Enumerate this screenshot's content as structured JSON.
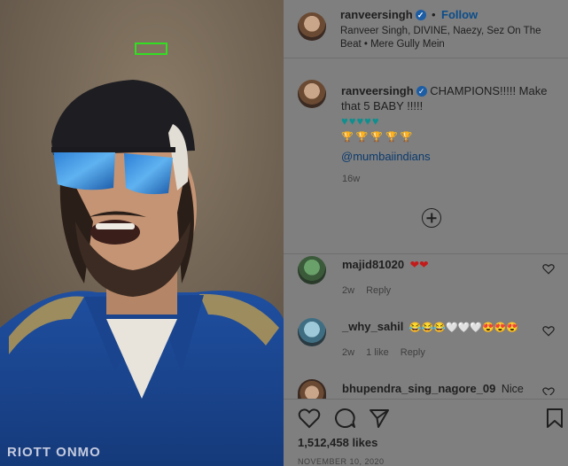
{
  "header": {
    "username": "ranveersingh",
    "dot": "•",
    "follow_label": "Follow",
    "audio": "Ranveer Singh, DIVINE, Naezy, Sez On The Beat • Mere Gully Mein"
  },
  "caption": {
    "username": "ranveersingh",
    "text": "CHAMPIONS!!!!! Make that 5 BABY !!!!!",
    "hearts": [
      "♥",
      "♥",
      "♥",
      "♥",
      "♥"
    ],
    "trophies": [
      "🏆",
      "🏆",
      "🏆",
      "🏆",
      "🏆"
    ],
    "mention": "@mumbaiindians",
    "time": "16w"
  },
  "comments": [
    {
      "username": "majid81020",
      "text": "❤❤",
      "time": "2w",
      "reply": "Reply",
      "likes": ""
    },
    {
      "username": "_why_sahil",
      "text": "😂😂😂🤍🤍🤍😍😍😍",
      "time": "2w",
      "likes": "1 like",
      "reply": "Reply"
    },
    {
      "username": "bhupendra_sing_nagore_09",
      "text": "Nice",
      "time": "",
      "reply": "",
      "likes": ""
    }
  ],
  "footer": {
    "likes": "1,512,458 likes",
    "date": "NOVEMBER 10, 2020"
  },
  "media": {
    "jersey_text": "RIOTT ONMO"
  },
  "colors": {
    "follow": "#0b4d8a",
    "verified": "#1d5da3",
    "highlight_box": "#33dd22",
    "hearts_comment": "#c41a1a",
    "hearts_caption": "#0f8f8f"
  },
  "icons": {
    "like": "heart-outline-icon",
    "comment": "speech-bubble-icon",
    "share": "paper-plane-icon",
    "save": "bookmark-icon",
    "more": "plus-circle-icon",
    "verified": "verified-badge-icon"
  }
}
